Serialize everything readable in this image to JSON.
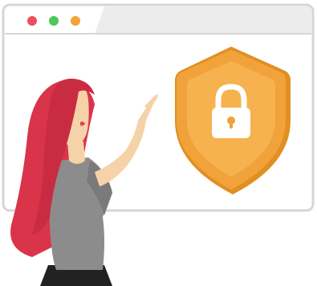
{
  "illustration": {
    "window_dots": [
      {
        "name": "close-dot",
        "color": "#e8505b"
      },
      {
        "name": "minimize-dot",
        "color": "#4cc75a"
      },
      {
        "name": "maximize-dot",
        "color": "#f2a33a"
      }
    ],
    "colors": {
      "window_frame": "#d8d8d8",
      "window_body": "#ffffff",
      "titlebar": "#ececec",
      "shield_outer": "#f2a23a",
      "shield_inner": "#f6b24e",
      "shield_shadow": "#e08f22",
      "lock": "#ffffff",
      "keyhole": "#f2a23a",
      "hair": "#d9344a",
      "skin": "#f6d2a8",
      "shirt": "#8c8c8c",
      "pants": "#222222"
    }
  }
}
